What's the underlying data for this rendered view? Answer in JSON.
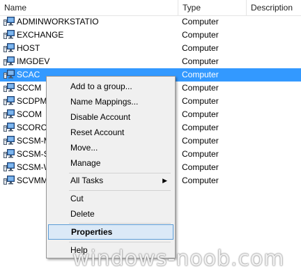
{
  "columns": {
    "name": "Name",
    "type": "Type",
    "description": "Description"
  },
  "rows": [
    {
      "name": "ADMINWORKSTATIO",
      "type": "Computer"
    },
    {
      "name": "EXCHANGE",
      "type": "Computer"
    },
    {
      "name": "HOST",
      "type": "Computer"
    },
    {
      "name": "IMGDEV",
      "type": "Computer"
    },
    {
      "name": "SCAC",
      "type": "Computer",
      "selected": true
    },
    {
      "name": "SCCM",
      "type": "Computer"
    },
    {
      "name": "SCDPM",
      "type": "Computer"
    },
    {
      "name": "SCOM",
      "type": "Computer"
    },
    {
      "name": "SCORCH",
      "type": "Computer"
    },
    {
      "name": "SCSM-M",
      "type": "Computer"
    },
    {
      "name": "SCSM-S",
      "type": "Computer"
    },
    {
      "name": "SCSM-W",
      "type": "Computer"
    },
    {
      "name": "SCVMM",
      "type": "Computer"
    }
  ],
  "icon": "computer-icon",
  "context_menu": {
    "items": {
      "add_to_group": "Add to a group...",
      "name_mappings": "Name Mappings...",
      "disable_account": "Disable Account",
      "reset_account": "Reset Account",
      "move": "Move...",
      "manage": "Manage",
      "all_tasks": "All Tasks",
      "cut": "Cut",
      "delete": "Delete",
      "properties": "Properties",
      "help": "Help"
    },
    "submenu_arrow": "▶"
  },
  "watermark": "windows-noob.com",
  "colors": {
    "selection": "#3399ff",
    "menu_bg": "#f0f0f0",
    "menu_highlight": "#dbe9f7",
    "menu_highlight_border": "#5a9bd6"
  }
}
